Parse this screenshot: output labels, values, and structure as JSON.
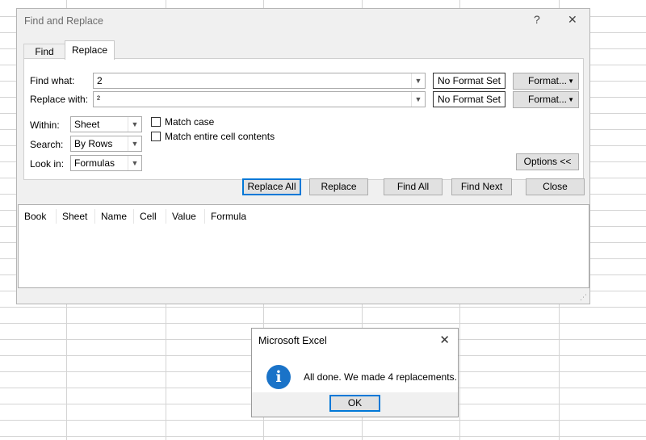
{
  "dialog": {
    "title": "Find and Replace",
    "help_glyph": "?",
    "close_glyph": "✕",
    "tabs": [
      {
        "label": "Find",
        "active": false
      },
      {
        "label": "Replace",
        "active": true
      }
    ],
    "find_what": {
      "label": "Find what:",
      "value": "2",
      "format_status": "No Format Set",
      "format_button": "Format..."
    },
    "replace_with": {
      "label": "Replace with:",
      "value": "²",
      "format_status": "No Format Set",
      "format_button": "Format..."
    },
    "within": {
      "label": "Within:",
      "value": "Sheet"
    },
    "search": {
      "label": "Search:",
      "value": "By Rows"
    },
    "look_in": {
      "label": "Look in:",
      "value": "Formulas"
    },
    "match_case": {
      "label": "Match case",
      "checked": false
    },
    "match_entire": {
      "label": "Match entire cell contents",
      "checked": false
    },
    "options_button": "Options <<",
    "buttons": {
      "replace_all": "Replace All",
      "replace": "Replace",
      "find_all": "Find All",
      "find_next": "Find Next",
      "close": "Close"
    },
    "results_columns": [
      "Book",
      "Sheet",
      "Name",
      "Cell",
      "Value",
      "Formula"
    ]
  },
  "message_box": {
    "title": "Microsoft Excel",
    "close_glyph": "✕",
    "icon": "info-icon",
    "text": "All done. We made 4 replacements.",
    "ok_label": "OK"
  },
  "colors": {
    "accent": "#0078d7",
    "info_icon": "#1a73c8",
    "dialog_bg": "#f0f0f0"
  }
}
